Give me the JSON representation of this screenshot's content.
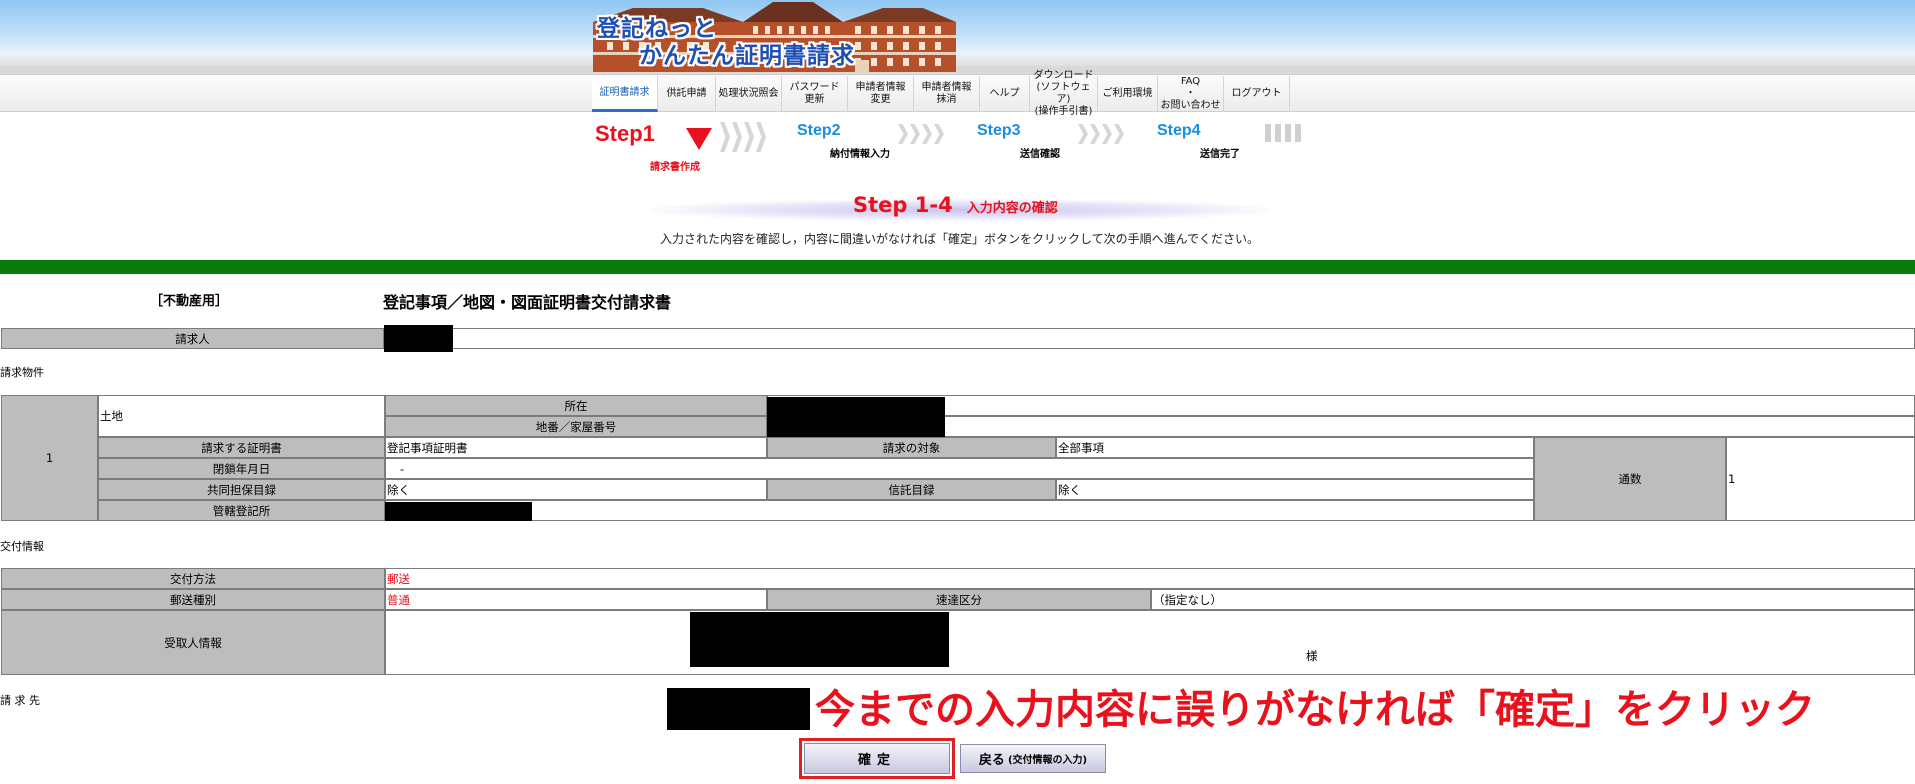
{
  "header": {
    "logo_line1": "登記ねっと",
    "logo_line2": "かんたん証明書請求"
  },
  "nav": [
    {
      "label": "証明書請求",
      "active": true
    },
    {
      "label": "供託申請"
    },
    {
      "label": "処理状況照会"
    },
    {
      "label": "パスワード\n更新"
    },
    {
      "label": "申請者情報\n変更"
    },
    {
      "label": "申請者情報\n抹消"
    },
    {
      "label": "ヘルプ"
    },
    {
      "label": "ダウンロード\n(ソフトウェア)\n(操作手引書)"
    },
    {
      "label": "ご利用環境"
    },
    {
      "label": "FAQ\n・\nお問い合わせ"
    },
    {
      "label": "ログアウト"
    }
  ],
  "steps": {
    "step1": "Step1",
    "step1_sub": "請求書作成",
    "step2": "Step2",
    "step2_sub": "納付情報入力",
    "step3": "Step3",
    "step3_sub": "送信確認",
    "step4": "Step4",
    "step4_sub": "送信完了"
  },
  "subheading": {
    "step": "Step 1-4",
    "title": "入力内容の確認"
  },
  "instruction": "入力された内容を確認し，内容に間違いがなければ「確定」ボタンをクリックして次の手順へ進んでください。",
  "form": {
    "dept_label": "［不動産用］",
    "title": "登記事項／地図・図面証明書交付請求書",
    "requester_label": "請求人",
    "property_section": "請求物件",
    "item_no": "1",
    "land": "土地",
    "location_label": "所在",
    "lot_label": "地番／家屋番号",
    "cert_label": "請求する証明書",
    "cert_value": "登記事項証明書",
    "target_label": "請求の対象",
    "target_value": "全部事項",
    "closing_label": "閉鎖年月日",
    "closing_value": "-",
    "joint_label": "共同担保目録",
    "joint_value": "除く",
    "trust_label": "信託目録",
    "trust_value": "除く",
    "registry_label": "管轄登記所",
    "copies_label": "通数",
    "copies_value": "1",
    "delivery_section": "交付情報",
    "method_label": "交付方法",
    "method_value": "郵送",
    "mail_type_label": "郵送種別",
    "mail_type_value": "普通",
    "express_label": "速達区分",
    "express_value": "（指定なし）",
    "recipient_label": "受取人情報",
    "honorific": "様",
    "dest_label": "請 求 先"
  },
  "annotation": "今までの入力内容に誤りがなければ「確定」をクリック",
  "buttons": {
    "confirm": "確定",
    "back": "戻る",
    "back_sub": "(交付情報の入力)"
  }
}
